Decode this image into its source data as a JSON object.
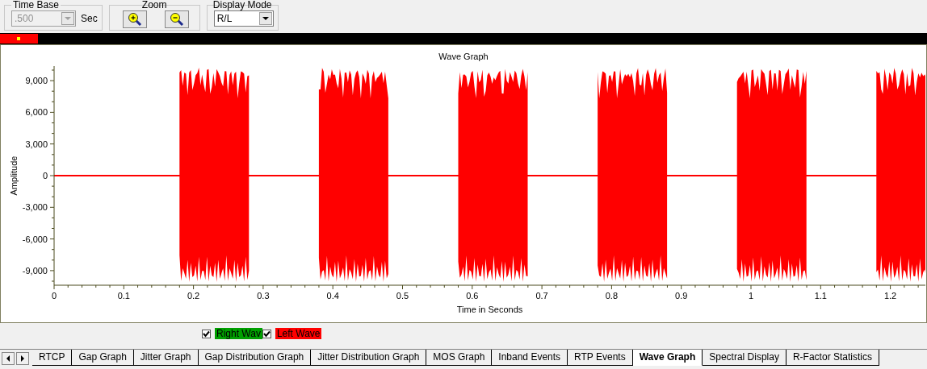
{
  "toolbar": {
    "time_base": {
      "label": "Time Base",
      "value": ".500",
      "disabled": true,
      "unit": "Sec"
    },
    "zoom": {
      "label": "Zoom"
    },
    "display_mode": {
      "label": "Display Mode",
      "value": "R/L"
    }
  },
  "chart": {
    "title": "Wave Graph",
    "ylabel": "Amplitude",
    "xlabel": "Time in Seconds",
    "yticks": [
      "9,000",
      "6,000",
      "3,000",
      "0",
      "-3,000",
      "-6,000",
      "-9,000"
    ],
    "xticks": [
      "0",
      "0.1",
      "0.2",
      "0.3",
      "0.4",
      "0.5",
      "0.6",
      "0.7",
      "0.8",
      "0.9",
      "1",
      "1.1",
      "1.2"
    ]
  },
  "legend": [
    {
      "label": "Right Wav",
      "checked": true,
      "color": "#00a000"
    },
    {
      "label": "Left Wave",
      "checked": true,
      "color": "#ff0000"
    }
  ],
  "tabs": [
    {
      "label": "RTCP",
      "selected": false
    },
    {
      "label": "Gap Graph",
      "selected": false
    },
    {
      "label": "Jitter Graph",
      "selected": false
    },
    {
      "label": "Gap Distribution Graph",
      "selected": false
    },
    {
      "label": "Jitter Distribution Graph",
      "selected": false
    },
    {
      "label": "MOS Graph",
      "selected": false
    },
    {
      "label": "Inband Events",
      "selected": false
    },
    {
      "label": "RTP Events",
      "selected": false
    },
    {
      "label": "Wave Graph",
      "selected": true
    },
    {
      "label": "Spectral Display",
      "selected": false
    },
    {
      "label": "R-Factor Statistics",
      "selected": false
    }
  ]
}
